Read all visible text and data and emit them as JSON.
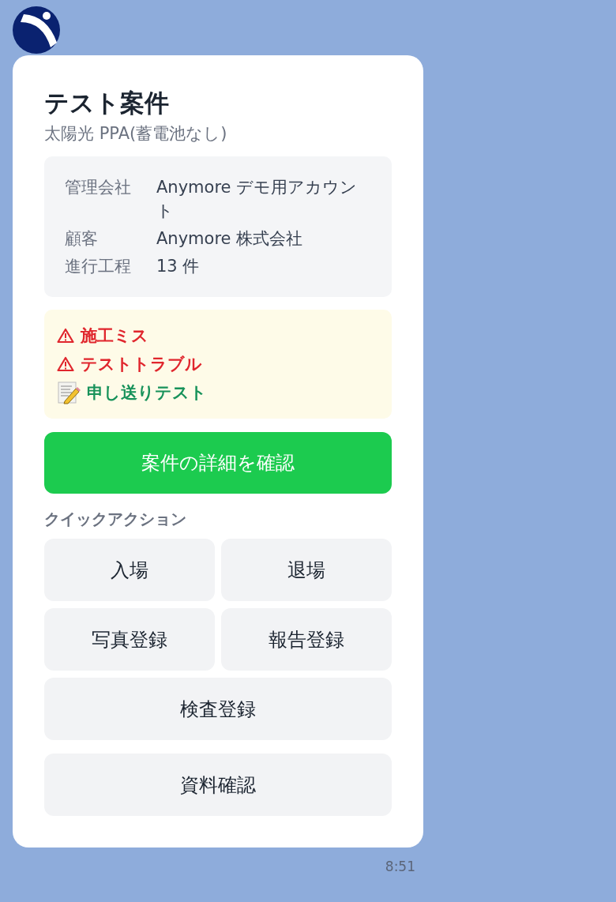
{
  "card": {
    "title": "テスト案件",
    "subtitle": "太陽光 PPA(蓄電池なし)",
    "info": [
      {
        "label": "管理会社",
        "value": "Anymore デモ用アカウント"
      },
      {
        "label": "顧客",
        "value": "Anymore 株式会社"
      },
      {
        "label": "進行工程",
        "value": "13 件"
      }
    ],
    "notes": [
      {
        "kind": "warning",
        "text": "施工ミス"
      },
      {
        "kind": "warning",
        "text": "テストトラブル"
      },
      {
        "kind": "memo",
        "text": "申し送りテスト"
      }
    ],
    "primary_button": "案件の詳細を確認",
    "section_title": "クイックアクション",
    "actions": [
      {
        "label": "入場",
        "kind": "half"
      },
      {
        "label": "退場",
        "kind": "half"
      },
      {
        "label": "写真登録",
        "kind": "half"
      },
      {
        "label": "報告登録",
        "kind": "half"
      },
      {
        "label": "検査登録",
        "kind": "full"
      },
      {
        "label": "資料確認",
        "kind": "full"
      }
    ]
  },
  "time": "8:51"
}
